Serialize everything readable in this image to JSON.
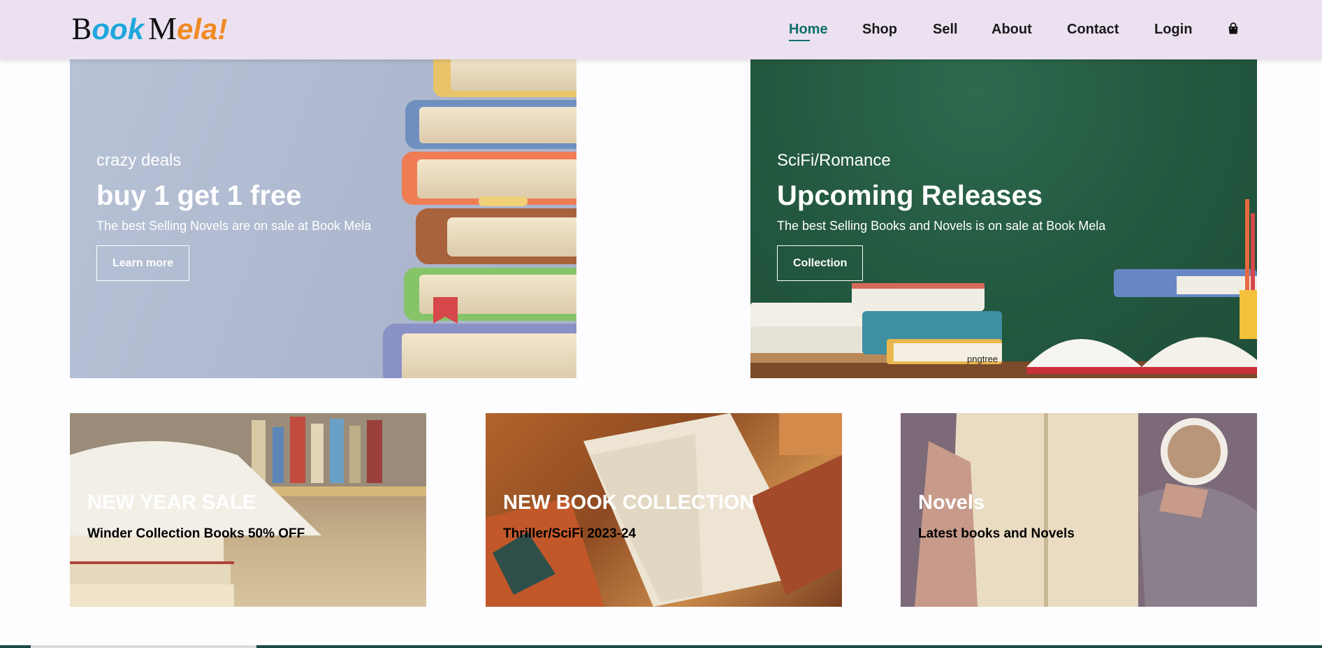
{
  "header": {
    "logo": {
      "part1": "B",
      "part2": "ook",
      "part3": "M",
      "part4": "ela!"
    },
    "nav": [
      {
        "label": "Home",
        "active": true
      },
      {
        "label": "Shop",
        "active": false
      },
      {
        "label": "Sell",
        "active": false
      },
      {
        "label": "About",
        "active": false
      },
      {
        "label": "Contact",
        "active": false
      },
      {
        "label": "Login",
        "active": false
      }
    ],
    "cart_icon": "shopping-bag-icon"
  },
  "heroes": [
    {
      "subtitle": "crazy deals",
      "title": "buy 1 get 1 free",
      "description": "The best Selling Novels are on sale at Book Mela",
      "button": "Learn more"
    },
    {
      "subtitle": "SciFi/Romance",
      "title": "Upcoming Releases",
      "description": "The best Selling Books and Novels is on sale at Book Mela",
      "button": "Collection",
      "watermark": "pngtree"
    }
  ],
  "cards": [
    {
      "title": "NEW YEAR SALE",
      "subtitle": "Winder Collection Books 50% OFF"
    },
    {
      "title": "NEW BOOK COLLECTION",
      "subtitle": "Thriller/SciFi 2023-24"
    },
    {
      "title": "Novels",
      "subtitle": "Latest books and Novels"
    }
  ],
  "colors": {
    "navbar_bg": "#ece1f0",
    "active_link": "#0d6f6a",
    "logo_blue": "#1ea7dc",
    "logo_orange": "#f08a24",
    "hero_left_bg": "#aeb8cf",
    "hero_right_bg": "#245a41"
  }
}
